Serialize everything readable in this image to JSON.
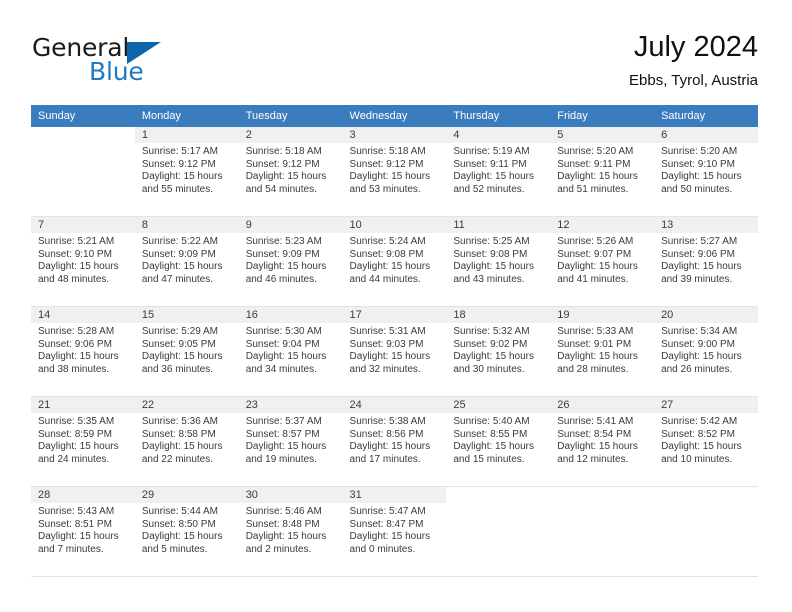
{
  "brand": {
    "name_part1": "General",
    "name_part2": "Blue",
    "logo_icon": "triangle-logo-icon"
  },
  "header": {
    "title": "July 2024",
    "subtitle": "Ebbs, Tyrol, Austria"
  },
  "calendar": {
    "weekday_headers": [
      "Sunday",
      "Monday",
      "Tuesday",
      "Wednesday",
      "Thursday",
      "Friday",
      "Saturday"
    ],
    "header_bg_color": "#3a7cbe",
    "daynum_bg_color": "#f0f0f0",
    "weeks": [
      [
        {
          "day": "",
          "lines": []
        },
        {
          "day": "1",
          "lines": [
            "Sunrise: 5:17 AM",
            "Sunset: 9:12 PM",
            "Daylight: 15 hours",
            "and 55 minutes."
          ]
        },
        {
          "day": "2",
          "lines": [
            "Sunrise: 5:18 AM",
            "Sunset: 9:12 PM",
            "Daylight: 15 hours",
            "and 54 minutes."
          ]
        },
        {
          "day": "3",
          "lines": [
            "Sunrise: 5:18 AM",
            "Sunset: 9:12 PM",
            "Daylight: 15 hours",
            "and 53 minutes."
          ]
        },
        {
          "day": "4",
          "lines": [
            "Sunrise: 5:19 AM",
            "Sunset: 9:11 PM",
            "Daylight: 15 hours",
            "and 52 minutes."
          ]
        },
        {
          "day": "5",
          "lines": [
            "Sunrise: 5:20 AM",
            "Sunset: 9:11 PM",
            "Daylight: 15 hours",
            "and 51 minutes."
          ]
        },
        {
          "day": "6",
          "lines": [
            "Sunrise: 5:20 AM",
            "Sunset: 9:10 PM",
            "Daylight: 15 hours",
            "and 50 minutes."
          ]
        }
      ],
      [
        {
          "day": "7",
          "lines": [
            "Sunrise: 5:21 AM",
            "Sunset: 9:10 PM",
            "Daylight: 15 hours",
            "and 48 minutes."
          ]
        },
        {
          "day": "8",
          "lines": [
            "Sunrise: 5:22 AM",
            "Sunset: 9:09 PM",
            "Daylight: 15 hours",
            "and 47 minutes."
          ]
        },
        {
          "day": "9",
          "lines": [
            "Sunrise: 5:23 AM",
            "Sunset: 9:09 PM",
            "Daylight: 15 hours",
            "and 46 minutes."
          ]
        },
        {
          "day": "10",
          "lines": [
            "Sunrise: 5:24 AM",
            "Sunset: 9:08 PM",
            "Daylight: 15 hours",
            "and 44 minutes."
          ]
        },
        {
          "day": "11",
          "lines": [
            "Sunrise: 5:25 AM",
            "Sunset: 9:08 PM",
            "Daylight: 15 hours",
            "and 43 minutes."
          ]
        },
        {
          "day": "12",
          "lines": [
            "Sunrise: 5:26 AM",
            "Sunset: 9:07 PM",
            "Daylight: 15 hours",
            "and 41 minutes."
          ]
        },
        {
          "day": "13",
          "lines": [
            "Sunrise: 5:27 AM",
            "Sunset: 9:06 PM",
            "Daylight: 15 hours",
            "and 39 minutes."
          ]
        }
      ],
      [
        {
          "day": "14",
          "lines": [
            "Sunrise: 5:28 AM",
            "Sunset: 9:06 PM",
            "Daylight: 15 hours",
            "and 38 minutes."
          ]
        },
        {
          "day": "15",
          "lines": [
            "Sunrise: 5:29 AM",
            "Sunset: 9:05 PM",
            "Daylight: 15 hours",
            "and 36 minutes."
          ]
        },
        {
          "day": "16",
          "lines": [
            "Sunrise: 5:30 AM",
            "Sunset: 9:04 PM",
            "Daylight: 15 hours",
            "and 34 minutes."
          ]
        },
        {
          "day": "17",
          "lines": [
            "Sunrise: 5:31 AM",
            "Sunset: 9:03 PM",
            "Daylight: 15 hours",
            "and 32 minutes."
          ]
        },
        {
          "day": "18",
          "lines": [
            "Sunrise: 5:32 AM",
            "Sunset: 9:02 PM",
            "Daylight: 15 hours",
            "and 30 minutes."
          ]
        },
        {
          "day": "19",
          "lines": [
            "Sunrise: 5:33 AM",
            "Sunset: 9:01 PM",
            "Daylight: 15 hours",
            "and 28 minutes."
          ]
        },
        {
          "day": "20",
          "lines": [
            "Sunrise: 5:34 AM",
            "Sunset: 9:00 PM",
            "Daylight: 15 hours",
            "and 26 minutes."
          ]
        }
      ],
      [
        {
          "day": "21",
          "lines": [
            "Sunrise: 5:35 AM",
            "Sunset: 8:59 PM",
            "Daylight: 15 hours",
            "and 24 minutes."
          ]
        },
        {
          "day": "22",
          "lines": [
            "Sunrise: 5:36 AM",
            "Sunset: 8:58 PM",
            "Daylight: 15 hours",
            "and 22 minutes."
          ]
        },
        {
          "day": "23",
          "lines": [
            "Sunrise: 5:37 AM",
            "Sunset: 8:57 PM",
            "Daylight: 15 hours",
            "and 19 minutes."
          ]
        },
        {
          "day": "24",
          "lines": [
            "Sunrise: 5:38 AM",
            "Sunset: 8:56 PM",
            "Daylight: 15 hours",
            "and 17 minutes."
          ]
        },
        {
          "day": "25",
          "lines": [
            "Sunrise: 5:40 AM",
            "Sunset: 8:55 PM",
            "Daylight: 15 hours",
            "and 15 minutes."
          ]
        },
        {
          "day": "26",
          "lines": [
            "Sunrise: 5:41 AM",
            "Sunset: 8:54 PM",
            "Daylight: 15 hours",
            "and 12 minutes."
          ]
        },
        {
          "day": "27",
          "lines": [
            "Sunrise: 5:42 AM",
            "Sunset: 8:52 PM",
            "Daylight: 15 hours",
            "and 10 minutes."
          ]
        }
      ],
      [
        {
          "day": "28",
          "lines": [
            "Sunrise: 5:43 AM",
            "Sunset: 8:51 PM",
            "Daylight: 15 hours",
            "and 7 minutes."
          ]
        },
        {
          "day": "29",
          "lines": [
            "Sunrise: 5:44 AM",
            "Sunset: 8:50 PM",
            "Daylight: 15 hours",
            "and 5 minutes."
          ]
        },
        {
          "day": "30",
          "lines": [
            "Sunrise: 5:46 AM",
            "Sunset: 8:48 PM",
            "Daylight: 15 hours",
            "and 2 minutes."
          ]
        },
        {
          "day": "31",
          "lines": [
            "Sunrise: 5:47 AM",
            "Sunset: 8:47 PM",
            "Daylight: 15 hours",
            "and 0 minutes."
          ]
        },
        {
          "day": "",
          "lines": []
        },
        {
          "day": "",
          "lines": []
        },
        {
          "day": "",
          "lines": []
        }
      ]
    ]
  }
}
